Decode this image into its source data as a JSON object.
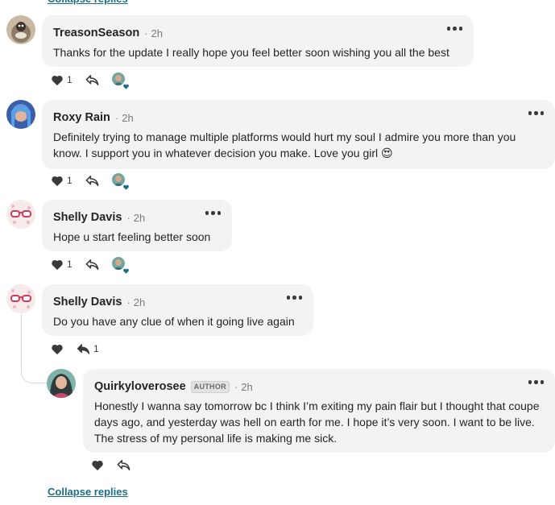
{
  "collapse_label": "Collapse replies",
  "comments": [
    {
      "author": "TreasonSeason",
      "time": "2h",
      "text": "Thanks for the update I really hope you feel better soon wishing you all the best",
      "likes": "1"
    },
    {
      "author": "Roxy Rain",
      "time": "2h",
      "text": "Definitely trying to manage multiple platforms would hurt my soul I admire you more than you know. I support you in whatever decision you make. Love you girl 😍",
      "likes": "1"
    },
    {
      "author": "Shelly Davis",
      "time": "2h",
      "text": "Hope u start feeling better soon",
      "likes": "1"
    },
    {
      "author": "Shelly Davis",
      "time": "2h",
      "text": "Do you have any clue of when it going live again",
      "replies": "1"
    }
  ],
  "reply": {
    "author": "Quirkyloverosee",
    "badge": "AUTHOR",
    "time": "2h",
    "text": "Honestly I wanna say tomorrow bc I think I’m exiting my pain flair but I thought that coupe days ago, and yesterday was hell on earth for me. I hope it’s very soon. I want to be live. The stress of my personal life is making me sick."
  },
  "separator": "·",
  "colors": {
    "link": "#1a6e86",
    "bubble": "#f3f3f3",
    "heart_badge": "#1a6e86"
  }
}
